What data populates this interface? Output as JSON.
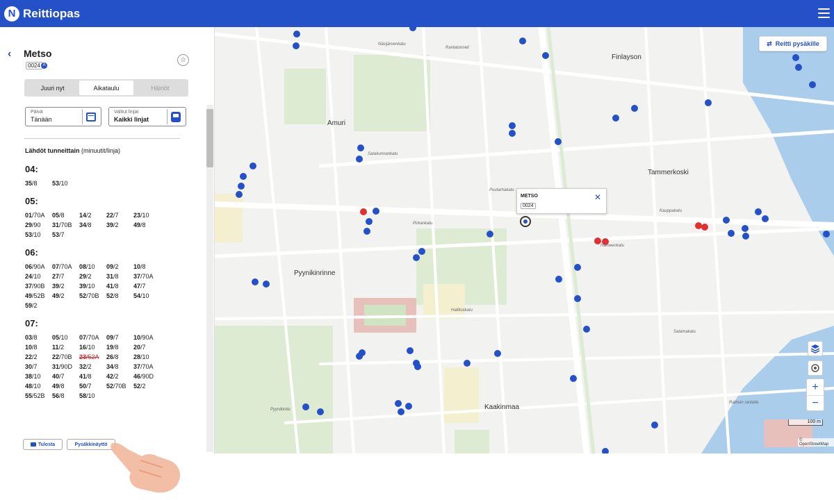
{
  "app": {
    "logo_letter": "N",
    "title": "Reittiopas"
  },
  "stop": {
    "back": "‹",
    "name": "Metso",
    "code": "0024",
    "favorite": "☆",
    "accessible_badge": "A"
  },
  "tabs": [
    {
      "label": "Juuri nyt",
      "state": "default"
    },
    {
      "label": "Aikataulu",
      "state": "active"
    },
    {
      "label": "Häiriöt",
      "state": "muted"
    }
  ],
  "filters": {
    "day": {
      "label": "Päivä",
      "value": "Tänään"
    },
    "lines": {
      "label": "Valitut linjat",
      "value": "Kaikki linjat"
    }
  },
  "departures": {
    "title_bold": "Lähdöt tunneittain",
    "title_rest": " (minuutit/linja)",
    "hours": [
      {
        "hour": "04:",
        "items": [
          {
            "min": "35",
            "line": "/8"
          },
          {
            "min": "53",
            "line": "/10"
          }
        ]
      },
      {
        "hour": "05:",
        "items": [
          {
            "min": "01",
            "line": "/70A"
          },
          {
            "min": "05",
            "line": "/8"
          },
          {
            "min": "14",
            "line": "/2"
          },
          {
            "min": "22",
            "line": "/7"
          },
          {
            "min": "23",
            "line": "/10"
          },
          {
            "min": "29",
            "line": "/90"
          },
          {
            "min": "31",
            "line": "/70B"
          },
          {
            "min": "34",
            "line": "/8"
          },
          {
            "min": "39",
            "line": "/2"
          },
          {
            "min": "49",
            "line": "/8"
          },
          {
            "min": "53",
            "line": "/10"
          },
          {
            "min": "53",
            "line": "/7"
          }
        ]
      },
      {
        "hour": "06:",
        "items": [
          {
            "min": "06",
            "line": "/90A"
          },
          {
            "min": "07",
            "line": "/70A"
          },
          {
            "min": "08",
            "line": "/10"
          },
          {
            "min": "09",
            "line": "/2"
          },
          {
            "min": "10",
            "line": "/8"
          },
          {
            "min": "24",
            "line": "/10"
          },
          {
            "min": "27",
            "line": "/7"
          },
          {
            "min": "29",
            "line": "/2"
          },
          {
            "min": "31",
            "line": "/8"
          },
          {
            "min": "37",
            "line": "/70A"
          },
          {
            "min": "37",
            "line": "/90B"
          },
          {
            "min": "39",
            "line": "/2"
          },
          {
            "min": "39",
            "line": "/10"
          },
          {
            "min": "41",
            "line": "/8"
          },
          {
            "min": "47",
            "line": "/7"
          },
          {
            "min": "49",
            "line": "/52B"
          },
          {
            "min": "49",
            "line": "/2"
          },
          {
            "min": "52",
            "line": "/70B"
          },
          {
            "min": "52",
            "line": "/8"
          },
          {
            "min": "54",
            "line": "/10"
          },
          {
            "min": "59",
            "line": "/2"
          }
        ]
      },
      {
        "hour": "07:",
        "items": [
          {
            "min": "03",
            "line": "/8"
          },
          {
            "min": "05",
            "line": "/10"
          },
          {
            "min": "07",
            "line": "/70A"
          },
          {
            "min": "09",
            "line": "/7"
          },
          {
            "min": "10",
            "line": "/90A"
          },
          {
            "min": "10",
            "line": "/8"
          },
          {
            "min": "11",
            "line": "/2"
          },
          {
            "min": "16",
            "line": "/10"
          },
          {
            "min": "19",
            "line": "/8"
          },
          {
            "min": "20",
            "line": "/7"
          },
          {
            "min": "22",
            "line": "/2"
          },
          {
            "min": "22",
            "line": "/70B"
          },
          {
            "min": "23",
            "line": "/52A",
            "cancelled": true
          },
          {
            "min": "26",
            "line": "/8"
          },
          {
            "min": "28",
            "line": "/10"
          },
          {
            "min": "30",
            "line": "/7"
          },
          {
            "min": "31",
            "line": "/90D"
          },
          {
            "min": "32",
            "line": "/2"
          },
          {
            "min": "34",
            "line": "/8"
          },
          {
            "min": "37",
            "line": "/70A"
          },
          {
            "min": "38",
            "line": "/10"
          },
          {
            "min": "40",
            "line": "/7"
          },
          {
            "min": "41",
            "line": "/8"
          },
          {
            "min": "42",
            "line": "/2"
          },
          {
            "min": "46",
            "line": "/90D"
          },
          {
            "min": "48",
            "line": "/10"
          },
          {
            "min": "49",
            "line": "/8"
          },
          {
            "min": "50",
            "line": "/7"
          },
          {
            "min": "52",
            "line": "/70B"
          },
          {
            "min": "52",
            "line": "/2"
          },
          {
            "min": "55",
            "line": "/52B"
          },
          {
            "min": "56",
            "line": "/8"
          },
          {
            "min": "58",
            "line": "/10"
          }
        ]
      }
    ]
  },
  "actions": {
    "print": "Tulosta",
    "display": "Pysäkkinäyttö"
  },
  "map": {
    "route_button": "Reitti pysäkille",
    "popup": {
      "title": "METSO",
      "code": "0024",
      "close": "✕"
    },
    "zoom_in": "+",
    "zoom_out": "−",
    "scale": "100 m",
    "attribution": "© OpenStreetMap",
    "areas": [
      "Amuri",
      "Finlayson",
      "Tammerkoski",
      "Pyynikinrinne",
      "Kaakinmaa"
    ],
    "streets": [
      "Pirkankatu",
      "Satakunnankatu",
      "Puutarhakatu",
      "Hämeenkatu",
      "Hallituskatu",
      "Satamakatu",
      "Pyynikintie",
      "Näsijärvenkatu",
      "Rantatunneli",
      "Kauppakatu",
      "Ratinan rantatie"
    ],
    "colors": {
      "water": "#a9cdea",
      "park": "#dcebd2",
      "road": "#ffffff",
      "stop": "#2450c8",
      "tram_stop": "#e03030"
    }
  }
}
